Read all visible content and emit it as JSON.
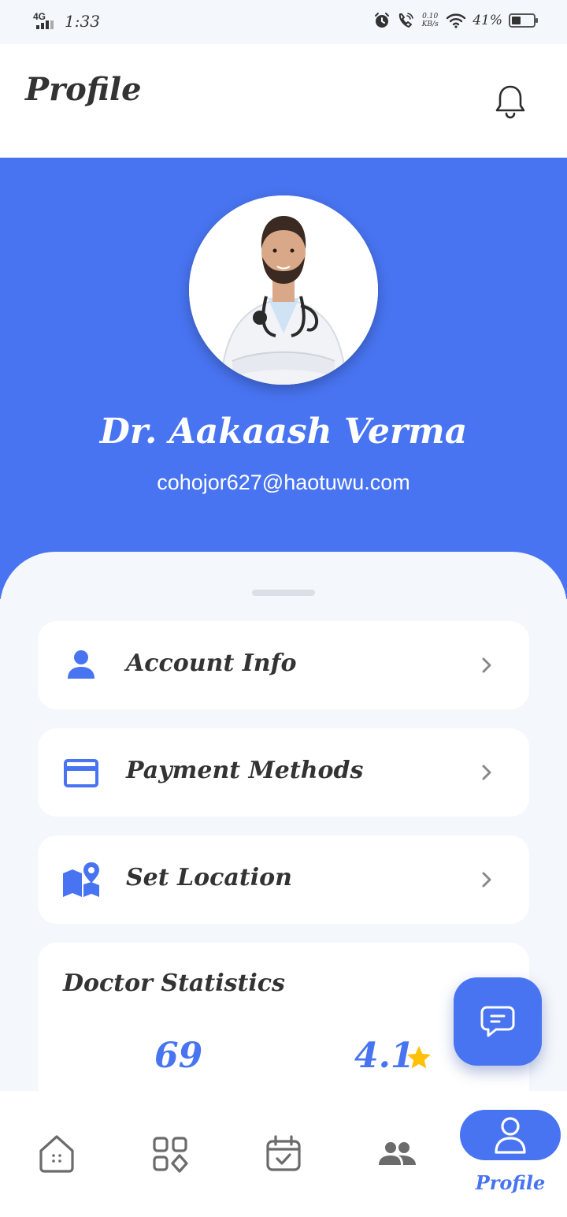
{
  "status_bar": {
    "network": "4G",
    "time": "1:33",
    "speed_value": "0.10",
    "speed_unit": "KB/s",
    "battery_percent": "41%",
    "battery_level": 0.41
  },
  "header": {
    "title": "Profile"
  },
  "profile": {
    "name": "Dr. Aakaash Verma",
    "email": "cohojor627@haotuwu.com"
  },
  "menu": {
    "items": [
      {
        "label": "Account Info",
        "icon": "person-icon"
      },
      {
        "label": "Payment Methods",
        "icon": "credit-card-icon"
      },
      {
        "label": "Set Location",
        "icon": "map-pin-icon"
      }
    ]
  },
  "stats": {
    "title": "Doctor Statistics",
    "patients": "69",
    "rating": "4.1"
  },
  "bottom_nav": {
    "items": [
      {
        "icon": "home-icon"
      },
      {
        "icon": "apps-grid-icon"
      },
      {
        "icon": "calendar-check-icon"
      },
      {
        "icon": "people-icon"
      },
      {
        "icon": "profile-icon",
        "label": "Profile",
        "active": true
      }
    ]
  },
  "colors": {
    "primary": "#4874f1",
    "background": "#f4f7fb",
    "card": "#ffffff",
    "text": "#333333",
    "star": "#ffc107"
  }
}
